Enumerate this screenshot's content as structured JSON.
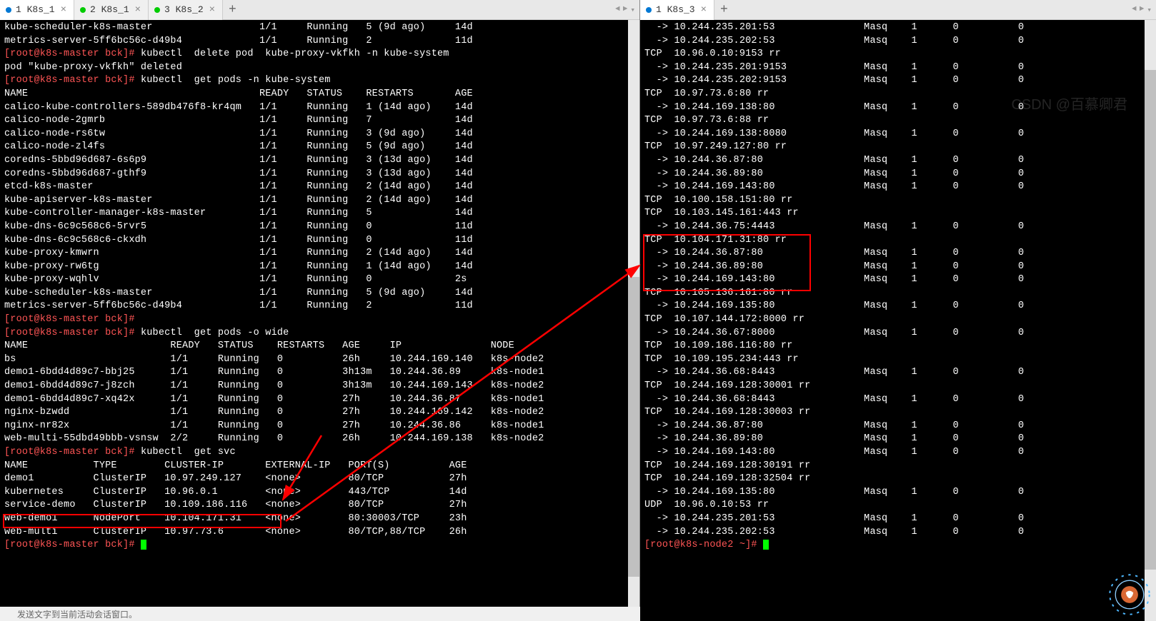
{
  "tabs_left": [
    {
      "label": "1 K8s_1",
      "dot": "dot-blue",
      "active": true
    },
    {
      "label": "2 K8s_1",
      "dot": "dot-green",
      "active": false
    },
    {
      "label": "3 K8s_2",
      "dot": "dot-green",
      "active": false
    }
  ],
  "tabs_right": [
    {
      "label": "1 K8s_3",
      "dot": "dot-blue",
      "active": true
    }
  ],
  "watermark": "CSDN @百慕卿君",
  "status_text": "发送文字到当前活动会话窗口。",
  "left_lines": [
    {
      "t": "kube-scheduler-k8s-master                  1/1     Running   5 (9d ago)     14d"
    },
    {
      "t": "metrics-server-5ff6bc56c-d49b4             1/1     Running   2              11d"
    },
    {
      "p": "[root@k8s-master bck]# ",
      "c": "kubectl  delete pod  kube-proxy-vkfkh -n kube-system"
    },
    {
      "t": "pod \"kube-proxy-vkfkh\" deleted"
    },
    {
      "p": "[root@k8s-master bck]# ",
      "c": "kubectl  get pods -n kube-system"
    },
    {
      "t": "NAME                                       READY   STATUS    RESTARTS       AGE"
    },
    {
      "t": "calico-kube-controllers-589db476f8-kr4qm   1/1     Running   1 (14d ago)    14d"
    },
    {
      "t": "calico-node-2gmrb                          1/1     Running   7              14d"
    },
    {
      "t": "calico-node-rs6tw                          1/1     Running   3 (9d ago)     14d"
    },
    {
      "t": "calico-node-zl4fs                          1/1     Running   5 (9d ago)     14d"
    },
    {
      "t": "coredns-5bbd96d687-6s6p9                   1/1     Running   3 (13d ago)    14d"
    },
    {
      "t": "coredns-5bbd96d687-gthf9                   1/1     Running   3 (13d ago)    14d"
    },
    {
      "t": "etcd-k8s-master                            1/1     Running   2 (14d ago)    14d"
    },
    {
      "t": "kube-apiserver-k8s-master                  1/1     Running   2 (14d ago)    14d"
    },
    {
      "t": "kube-controller-manager-k8s-master         1/1     Running   5              14d"
    },
    {
      "t": "kube-dns-6c9c568c6-5rvr5                   1/1     Running   0              11d"
    },
    {
      "t": "kube-dns-6c9c568c6-ckxdh                   1/1     Running   0              11d"
    },
    {
      "t": "kube-proxy-kmwrn                           1/1     Running   2 (14d ago)    14d"
    },
    {
      "t": "kube-proxy-rw6tg                           1/1     Running   1 (14d ago)    14d"
    },
    {
      "t": "kube-proxy-wqhlv                           1/1     Running   0              2s"
    },
    {
      "t": "kube-scheduler-k8s-master                  1/1     Running   5 (9d ago)     14d"
    },
    {
      "t": "metrics-server-5ff6bc56c-d49b4             1/1     Running   2              11d"
    },
    {
      "p": "[root@k8s-master bck]# ",
      "c": ""
    },
    {
      "p": "[root@k8s-master bck]# ",
      "c": "kubectl  get pods -o wide"
    },
    {
      "t": "NAME                        READY   STATUS    RESTARTS   AGE     IP               NODE"
    },
    {
      "t": "bs                          1/1     Running   0          26h     10.244.169.140   k8s-node2"
    },
    {
      "t": "demo1-6bdd4d89c7-bbj25      1/1     Running   0          3h13m   10.244.36.89     k8s-node1"
    },
    {
      "t": "demo1-6bdd4d89c7-j8zch      1/1     Running   0          3h13m   10.244.169.143   k8s-node2"
    },
    {
      "t": "demo1-6bdd4d89c7-xq42x      1/1     Running   0          27h     10.244.36.87     k8s-node1"
    },
    {
      "t": "nginx-bzwdd                 1/1     Running   0          27h     10.244.169.142   k8s-node2"
    },
    {
      "t": "nginx-nr82x                 1/1     Running   0          27h     10.244.36.86     k8s-node1"
    },
    {
      "t": "web-multi-55dbd49bbb-vsnsw  2/2     Running   0          26h     10.244.169.138   k8s-node2"
    },
    {
      "p": "[root@k8s-master bck]# ",
      "c": "kubectl  get svc"
    },
    {
      "t": "NAME           TYPE        CLUSTER-IP       EXTERNAL-IP   PORT(S)          AGE"
    },
    {
      "t": "demo1          ClusterIP   10.97.249.127    <none>        80/TCP           27h"
    },
    {
      "t": "kubernetes     ClusterIP   10.96.0.1        <none>        443/TCP          14d"
    },
    {
      "t": "service-demo   ClusterIP   10.109.186.116   <none>        80/TCP           27h"
    },
    {
      "t": "web-demo1      NodePort    10.104.171.31    <none>        80:30003/TCP     23h"
    },
    {
      "t": "web-multi      ClusterIP   10.97.73.6       <none>        80/TCP,88/TCP    26h"
    },
    {
      "p": "[root@k8s-master bck]# ",
      "c": "",
      "cursor": true
    }
  ],
  "right_lines": [
    {
      "t": "  -> 10.244.235.201:53               Masq    1      0          0"
    },
    {
      "t": "  -> 10.244.235.202:53               Masq    1      0          0"
    },
    {
      "t": "TCP  10.96.0.10:9153 rr"
    },
    {
      "t": "  -> 10.244.235.201:9153             Masq    1      0          0"
    },
    {
      "t": "  -> 10.244.235.202:9153             Masq    1      0          0"
    },
    {
      "t": "TCP  10.97.73.6:80 rr"
    },
    {
      "t": "  -> 10.244.169.138:80               Masq    1      0          0"
    },
    {
      "t": "TCP  10.97.73.6:88 rr"
    },
    {
      "t": "  -> 10.244.169.138:8080             Masq    1      0          0"
    },
    {
      "t": "TCP  10.97.249.127:80 rr"
    },
    {
      "t": "  -> 10.244.36.87:80                 Masq    1      0          0"
    },
    {
      "t": "  -> 10.244.36.89:80                 Masq    1      0          0"
    },
    {
      "t": "  -> 10.244.169.143:80               Masq    1      0          0"
    },
    {
      "t": "TCP  10.100.158.151:80 rr"
    },
    {
      "t": "TCP  10.103.145.161:443 rr"
    },
    {
      "t": "  -> 10.244.36.75:4443               Masq    1      0          0"
    },
    {
      "t": "TCP  10.104.171.31:80 rr"
    },
    {
      "t": "  -> 10.244.36.87:80                 Masq    1      0          0"
    },
    {
      "t": "  -> 10.244.36.89:80                 Masq    1      0          0"
    },
    {
      "t": "  -> 10.244.169.143:80               Masq    1      0          0"
    },
    {
      "t": "TCP  10.105.136.161:80 rr"
    },
    {
      "t": "  -> 10.244.169.135:80               Masq    1      0          0"
    },
    {
      "t": "TCP  10.107.144.172:8000 rr"
    },
    {
      "t": "  -> 10.244.36.67:8000               Masq    1      0          0"
    },
    {
      "t": "TCP  10.109.186.116:80 rr"
    },
    {
      "t": "TCP  10.109.195.234:443 rr"
    },
    {
      "t": "  -> 10.244.36.68:8443               Masq    1      0          0"
    },
    {
      "t": "TCP  10.244.169.128:30001 rr"
    },
    {
      "t": "  -> 10.244.36.68:8443               Masq    1      0          0"
    },
    {
      "t": "TCP  10.244.169.128:30003 rr"
    },
    {
      "t": "  -> 10.244.36.87:80                 Masq    1      0          0"
    },
    {
      "t": "  -> 10.244.36.89:80                 Masq    1      0          0"
    },
    {
      "t": "  -> 10.244.169.143:80               Masq    1      0          0"
    },
    {
      "t": "TCP  10.244.169.128:30191 rr"
    },
    {
      "t": "TCP  10.244.169.128:32504 rr"
    },
    {
      "t": "  -> 10.244.169.135:80               Masq    1      0          0"
    },
    {
      "t": "UDP  10.96.0.10:53 rr"
    },
    {
      "t": "  -> 10.244.235.201:53               Masq    1      0          0"
    },
    {
      "t": "  -> 10.244.235.202:53               Masq    1      0          0"
    },
    {
      "p": "[root@k8s-node2 ~]# ",
      "c": "",
      "cursor": true
    }
  ]
}
